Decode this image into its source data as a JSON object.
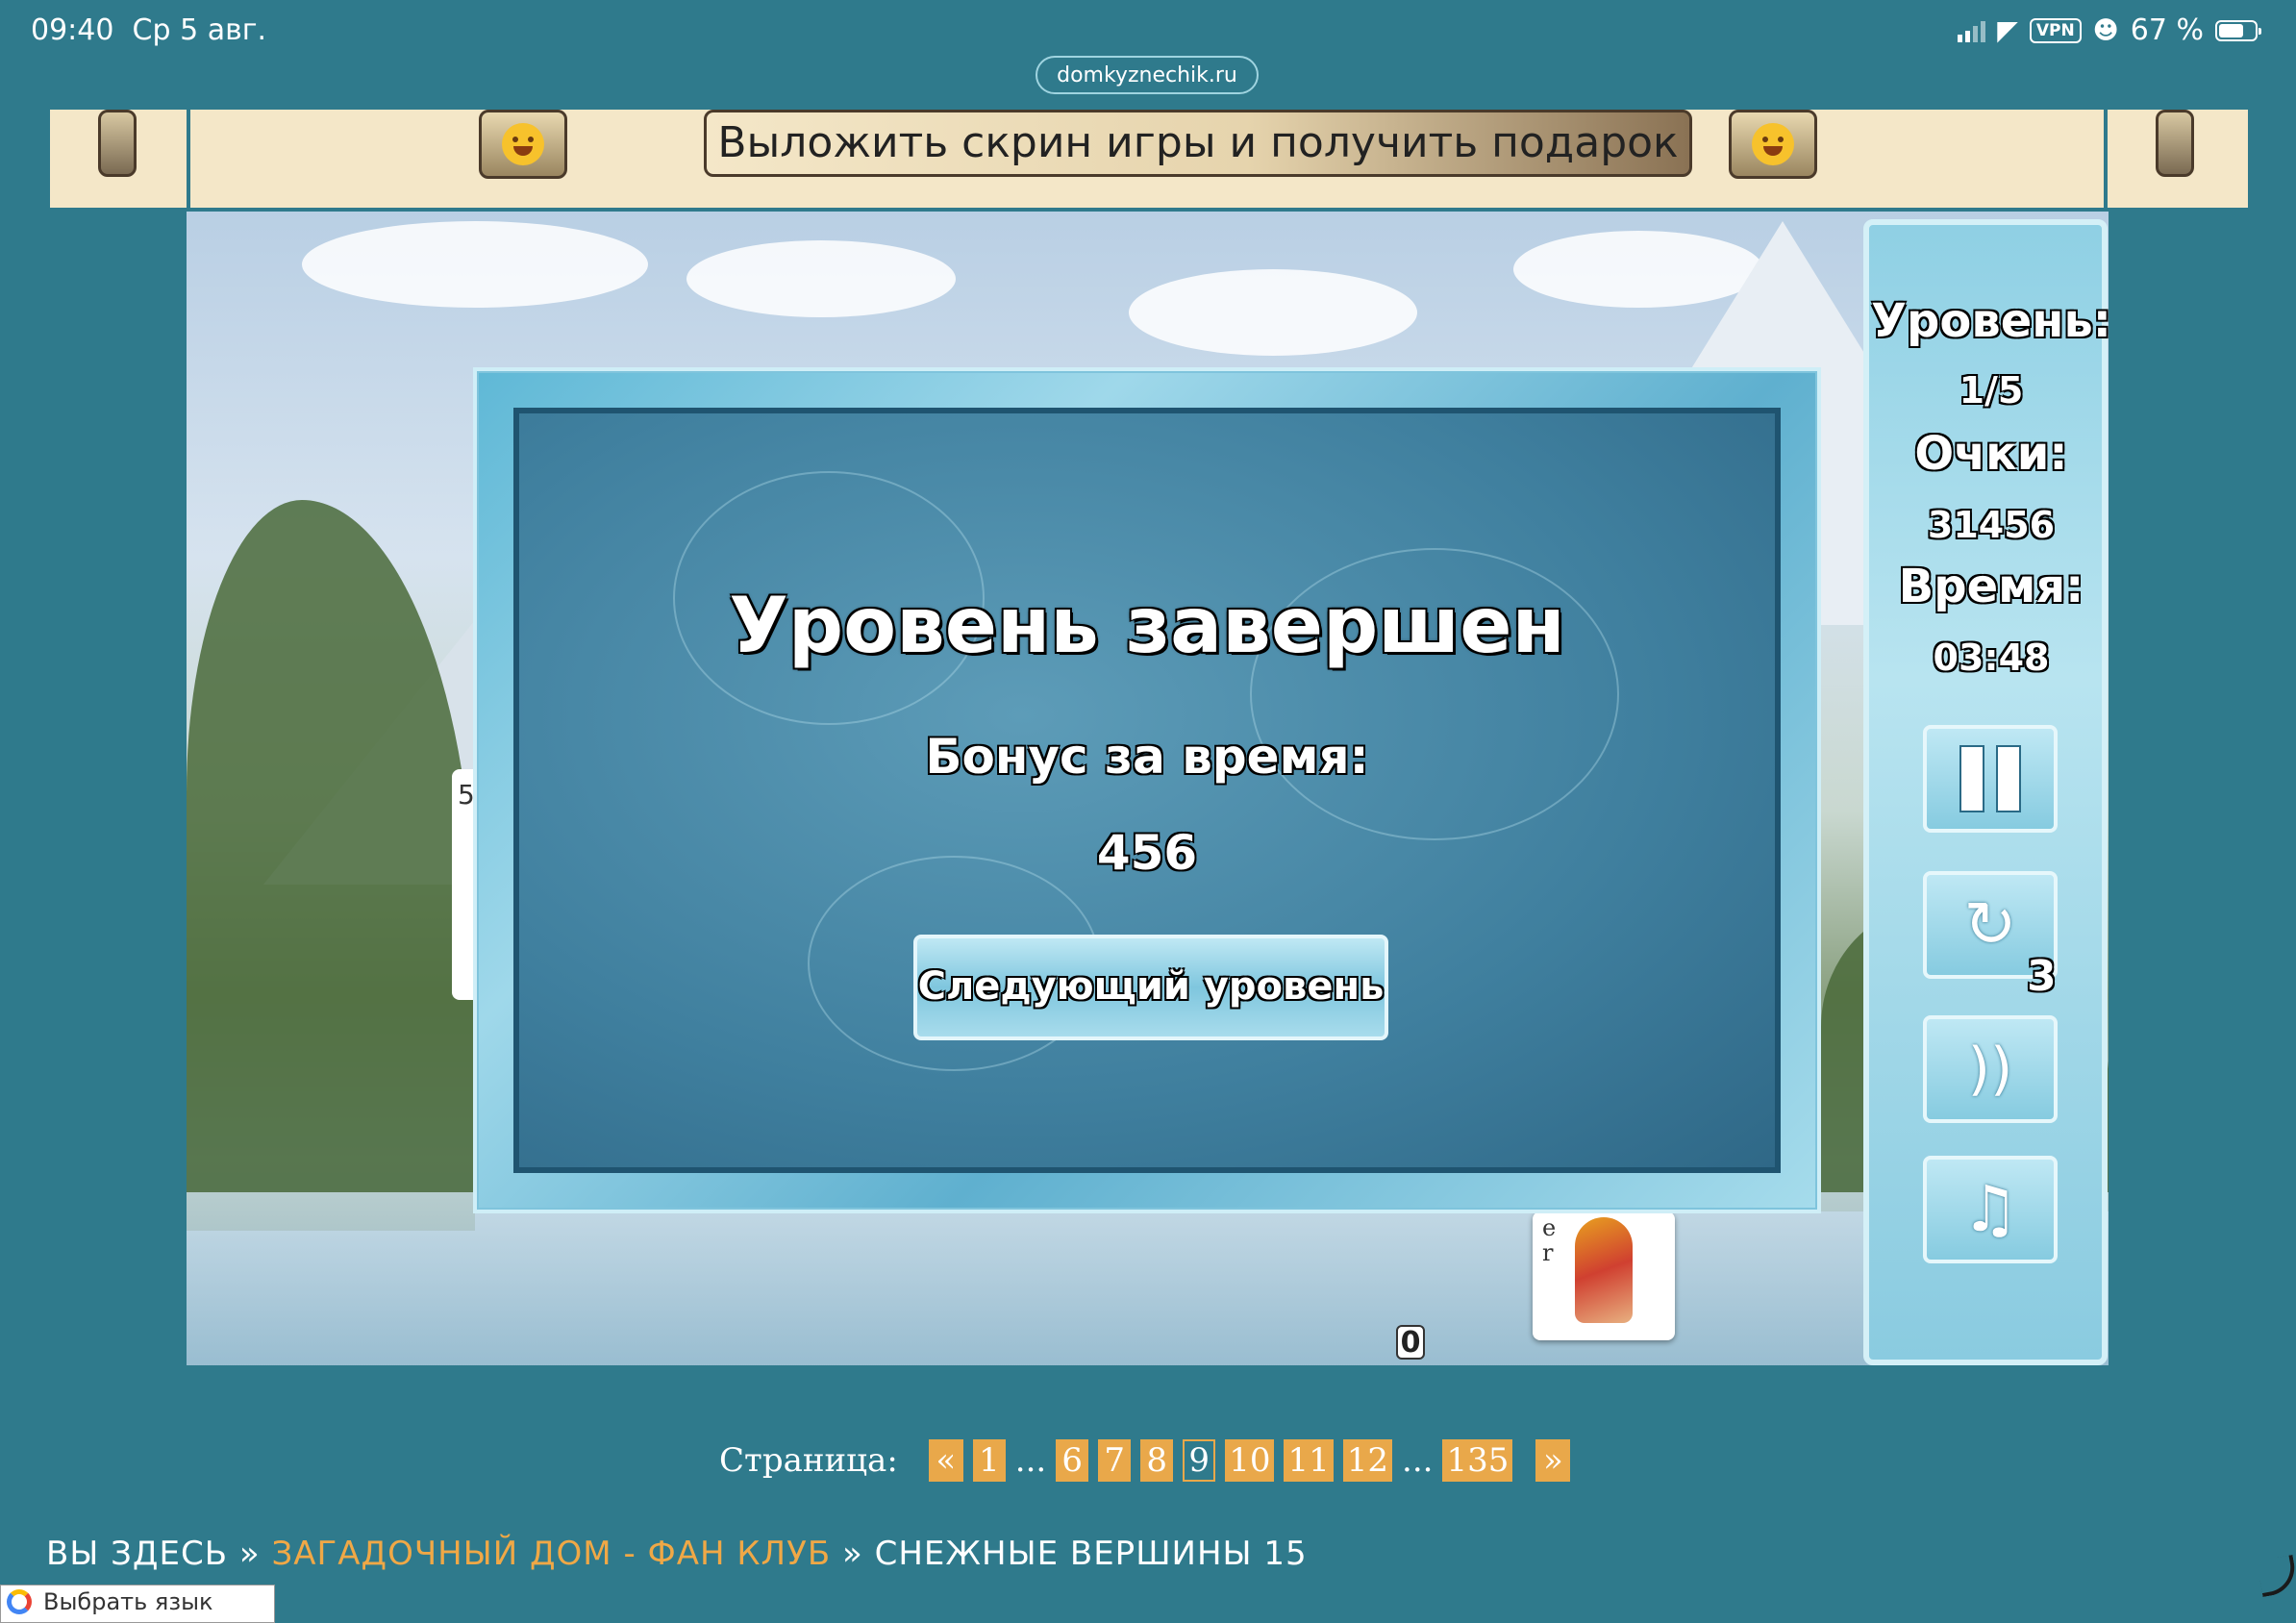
{
  "status_bar": {
    "time": "09:40",
    "date": "Ср 5 авг.",
    "vpn": "VPN",
    "battery": "67 %"
  },
  "browser": {
    "url": "domkyznechik.ru"
  },
  "banner": {
    "share_label": "Выложить скрин игры и получить подарок"
  },
  "dialog": {
    "title": "Уровень завершен",
    "bonus_label": "Бонус за время:",
    "bonus_value": "456",
    "next_button": "Следующий уровень"
  },
  "panel": {
    "level_label": "Уровень:",
    "level_value": "1/5",
    "score_label": "Очки:",
    "score_value": "31456",
    "time_label": "Время:",
    "time_value": "03:48",
    "undo_count": "3",
    "buttons": [
      "pause-icon",
      "undo-icon",
      "sound-icon",
      "music-icon"
    ]
  },
  "board": {
    "deck_count": "0",
    "card_left_fragment": "5",
    "card_peek_letters": "e r"
  },
  "pagination": {
    "label": "Страница:",
    "prev": "«",
    "first": "1",
    "ellipsis": "...",
    "pages": [
      "6",
      "7",
      "8",
      "9",
      "10",
      "11",
      "12"
    ],
    "current": "9",
    "last": "135",
    "next": "»"
  },
  "breadcrumb": {
    "prefix": "ВЫ ЗДЕСЬ",
    "sep": "»",
    "section": "ЗАГАДОЧНЫЙ ДОМ - ФАН КЛУБ",
    "current": "СНЕЖНЫЕ ВЕРШИНЫ 15"
  },
  "translate_widget": {
    "label": "Выбрать язык"
  },
  "colors": {
    "page_bg": "#2f7a8c",
    "banner_bg": "#f4e7c8",
    "link": "#f0a846",
    "page_button": "#e9a84a"
  }
}
